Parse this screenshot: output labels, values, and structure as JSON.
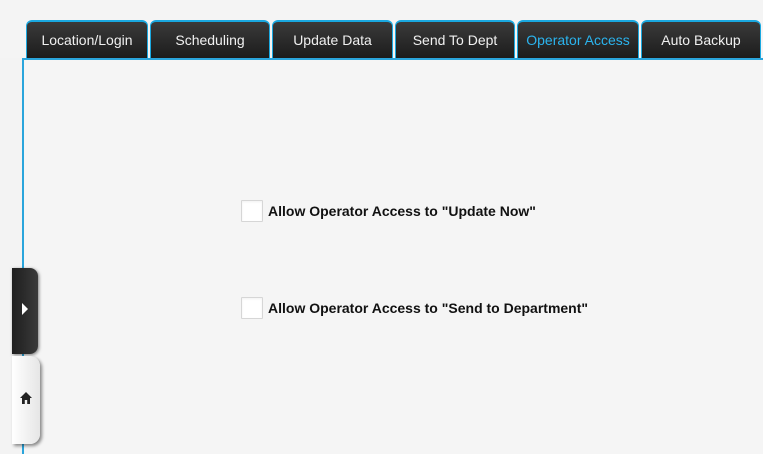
{
  "tabs": [
    {
      "label": "Location/Login"
    },
    {
      "label": "Scheduling"
    },
    {
      "label": "Update Data"
    },
    {
      "label": "Send To Dept"
    },
    {
      "label": "Operator Access",
      "active": true
    },
    {
      "label": "Auto Backup"
    }
  ],
  "options": [
    {
      "label": "Allow Operator Access to \"Update Now\"",
      "checked": false
    },
    {
      "label": "Allow Operator Access to \"Send to Department\"",
      "checked": false
    }
  ],
  "colors": {
    "accent": "#2aa5dc",
    "tab_bg": "#262626",
    "active_tab_text": "#2bb4ee"
  },
  "icons": {
    "expand": "chevron-right-icon",
    "home": "home-icon"
  }
}
